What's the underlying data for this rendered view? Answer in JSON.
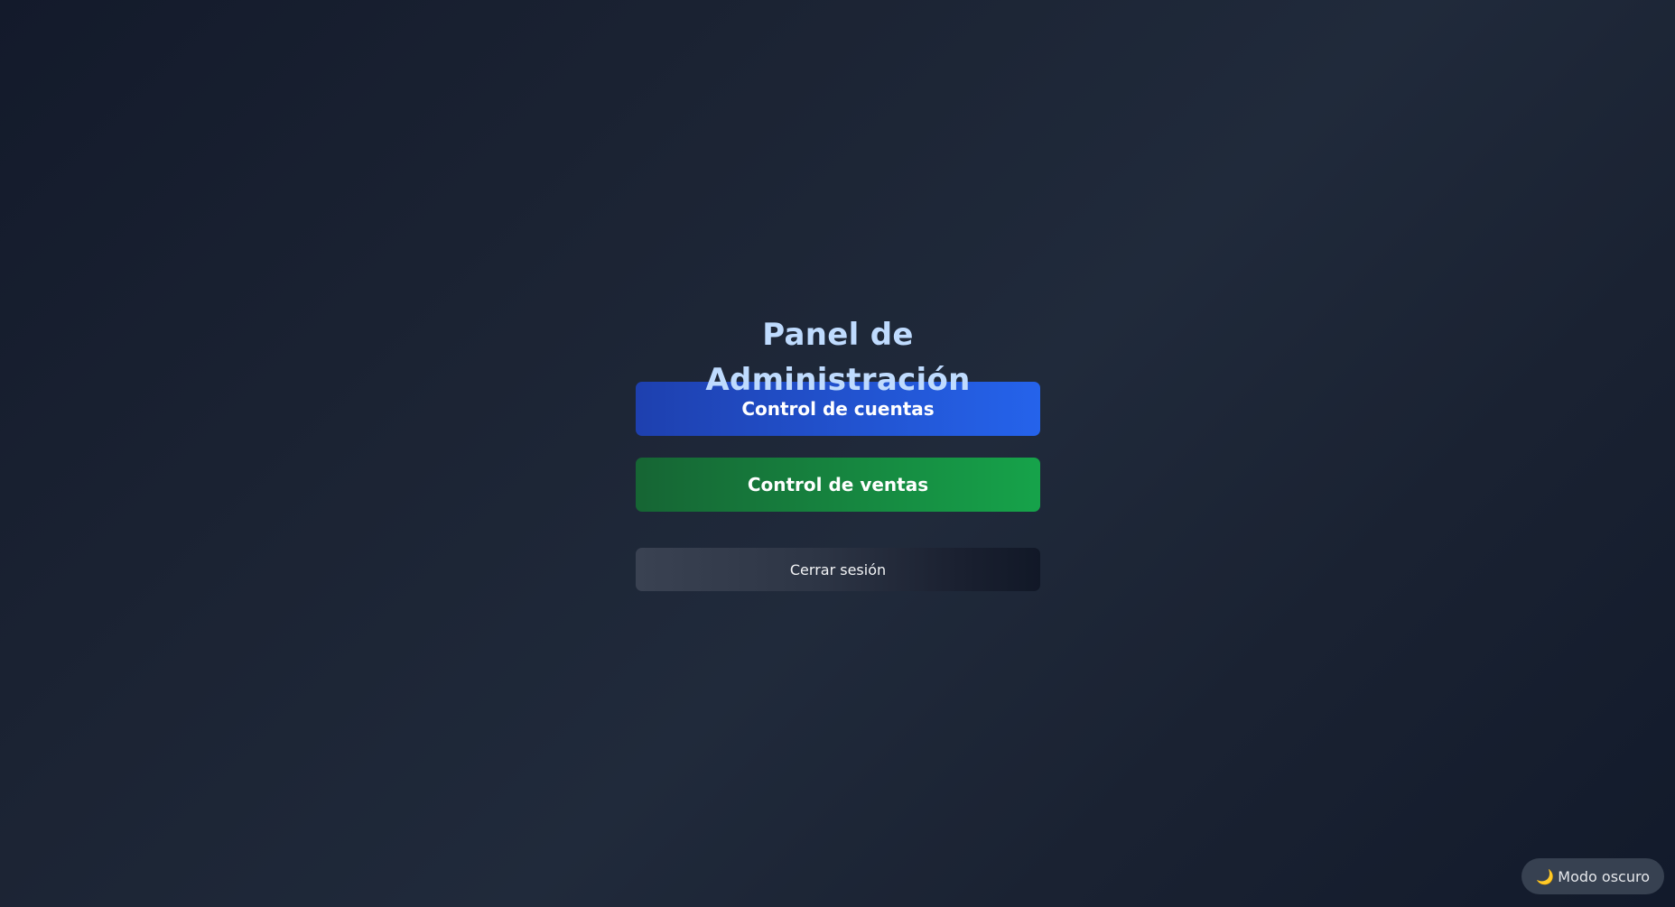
{
  "panel": {
    "title": "Panel de Administración",
    "accounts_button": "Control de cuentas",
    "sales_button": "Control de ventas",
    "logout_button": "Cerrar sesión"
  },
  "theme_toggle": {
    "icon": "moon-icon",
    "label": "Modo oscuro"
  },
  "colors": {
    "title": "#bfdbfe",
    "accounts_button": "#2563eb",
    "sales_button": "#16a34a",
    "logout_button": "#2d3545"
  }
}
